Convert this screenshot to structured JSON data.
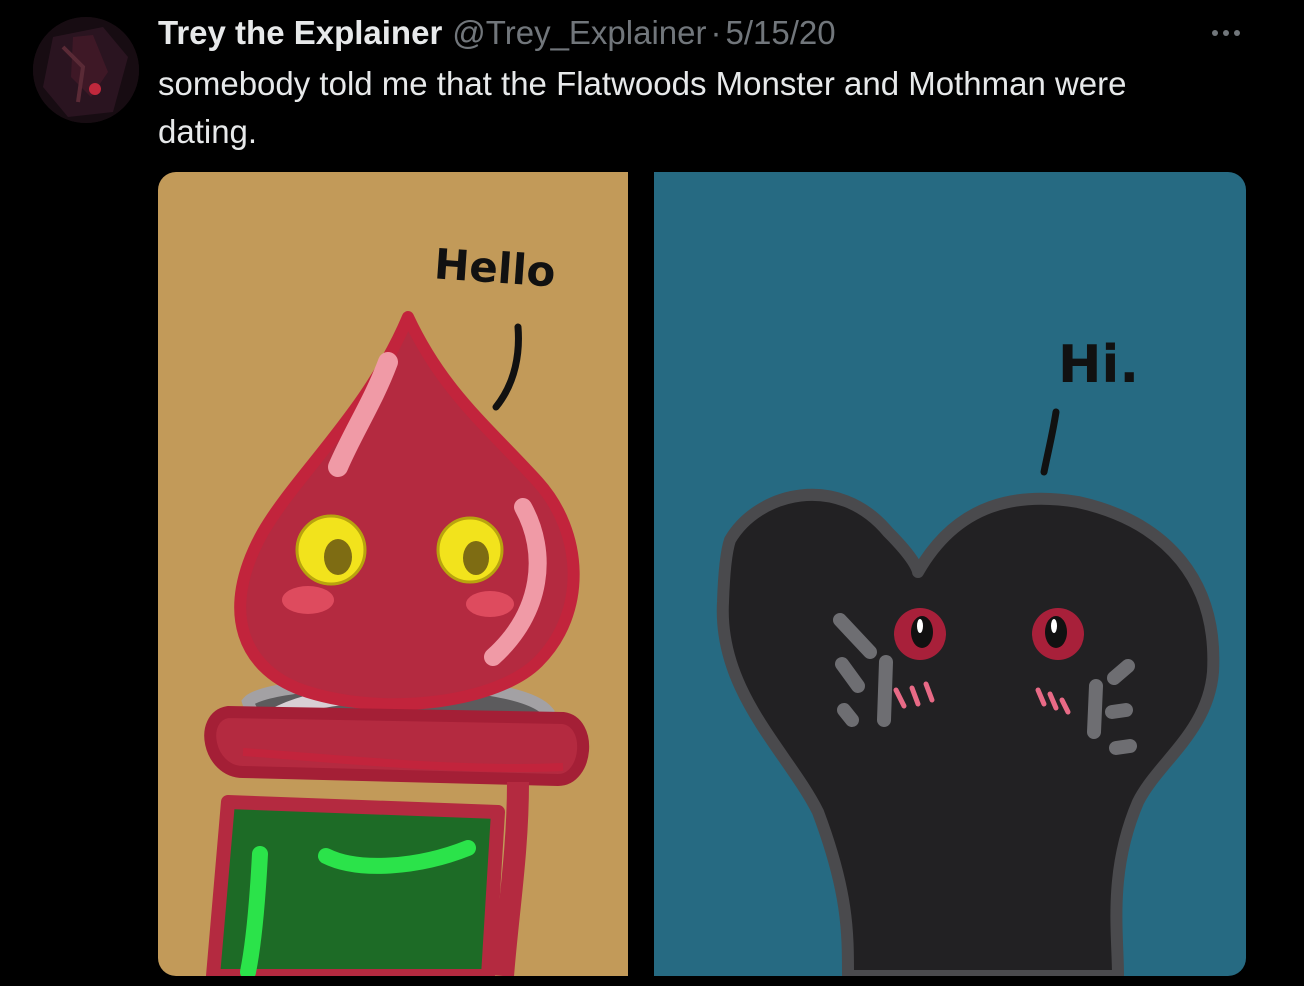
{
  "tweet": {
    "display_name": "Trey the Explainer",
    "handle": "@Trey_Explainer",
    "separator": "·",
    "date": "5/15/20",
    "text": "somebody told me that the Flatwoods Monster and Mothman were dating.",
    "more_icon": "more-horizontal-icon",
    "avatar_icon": "profile-avatar"
  },
  "media": {
    "left_panel_caption": "Hello",
    "right_panel_caption": "Hi.",
    "colors": {
      "left_bg": "#c29a59",
      "right_bg": "#266a82",
      "flatwoods_red": "#b42a40",
      "mothman_body": "#222123"
    }
  }
}
